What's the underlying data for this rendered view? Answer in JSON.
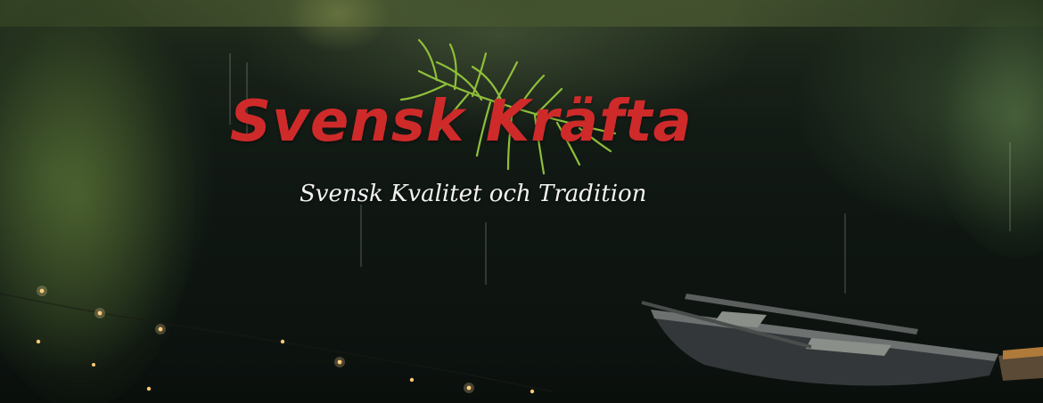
{
  "brand": {
    "title": "Svensk Kräfta",
    "tagline": "Svensk Kvalitet och Tradition",
    "title_color": "#cf2a2a",
    "tagline_color": "#f2f2f2",
    "dill_color": "#8fbf3a"
  },
  "scene": {
    "water_color": "#0f1612",
    "foliage_color": "#5f7a37",
    "light_color": "#ffc875",
    "boat_color": "#3a3e3c"
  }
}
